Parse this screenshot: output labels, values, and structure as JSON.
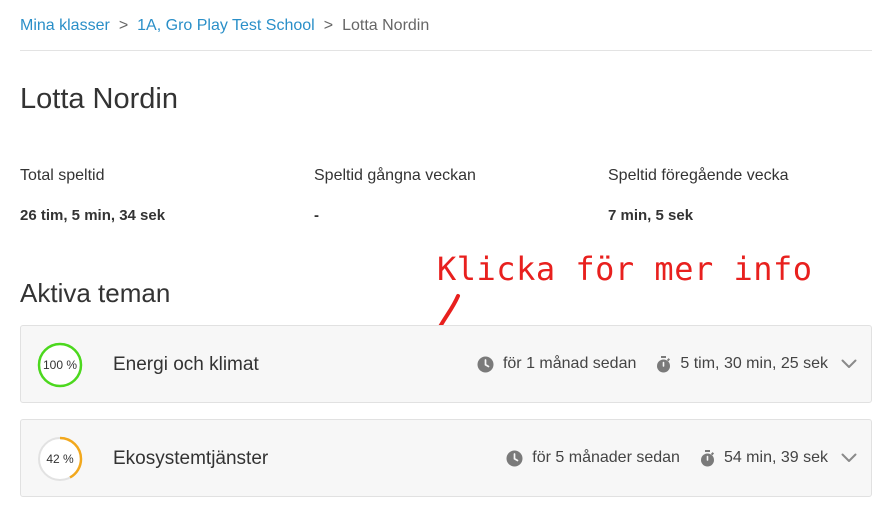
{
  "breadcrumb": {
    "items": [
      "Mina klasser",
      "1A, Gro Play Test School"
    ],
    "separator": ">",
    "current": "Lotta Nordin"
  },
  "student": {
    "name": "Lotta Nordin"
  },
  "stats": [
    {
      "label": "Total speltid",
      "value": "26 tim, 5 min, 34 sek"
    },
    {
      "label": "Speltid gångna veckan",
      "value": "-"
    },
    {
      "label": "Speltid föregående vecka",
      "value": "7 min, 5 sek"
    }
  ],
  "annotation": {
    "text": "Klicka för mer info",
    "color": "#e8201e"
  },
  "section": {
    "title": "Aktiva teman"
  },
  "themes": [
    {
      "progress": 100,
      "progress_label": "100 %",
      "ring_color": "#4cd81e",
      "name": "Energi och klimat",
      "last_played": "för 1 månad sedan",
      "duration": "5 tim, 30 min, 25 sek"
    },
    {
      "progress": 42,
      "progress_label": "42 %",
      "ring_color": "#f2a81d",
      "name": "Ekosystemtjänster",
      "last_played": "för 5 månader sedan",
      "duration": "54 min, 39 sek"
    }
  ],
  "colors": {
    "link": "#2a8fc8",
    "text": "#333333",
    "ring_track": "#e2e2e2"
  },
  "icons": {
    "time": "clock-icon",
    "duration": "stopwatch-icon",
    "expand": "chevron-down-icon"
  }
}
